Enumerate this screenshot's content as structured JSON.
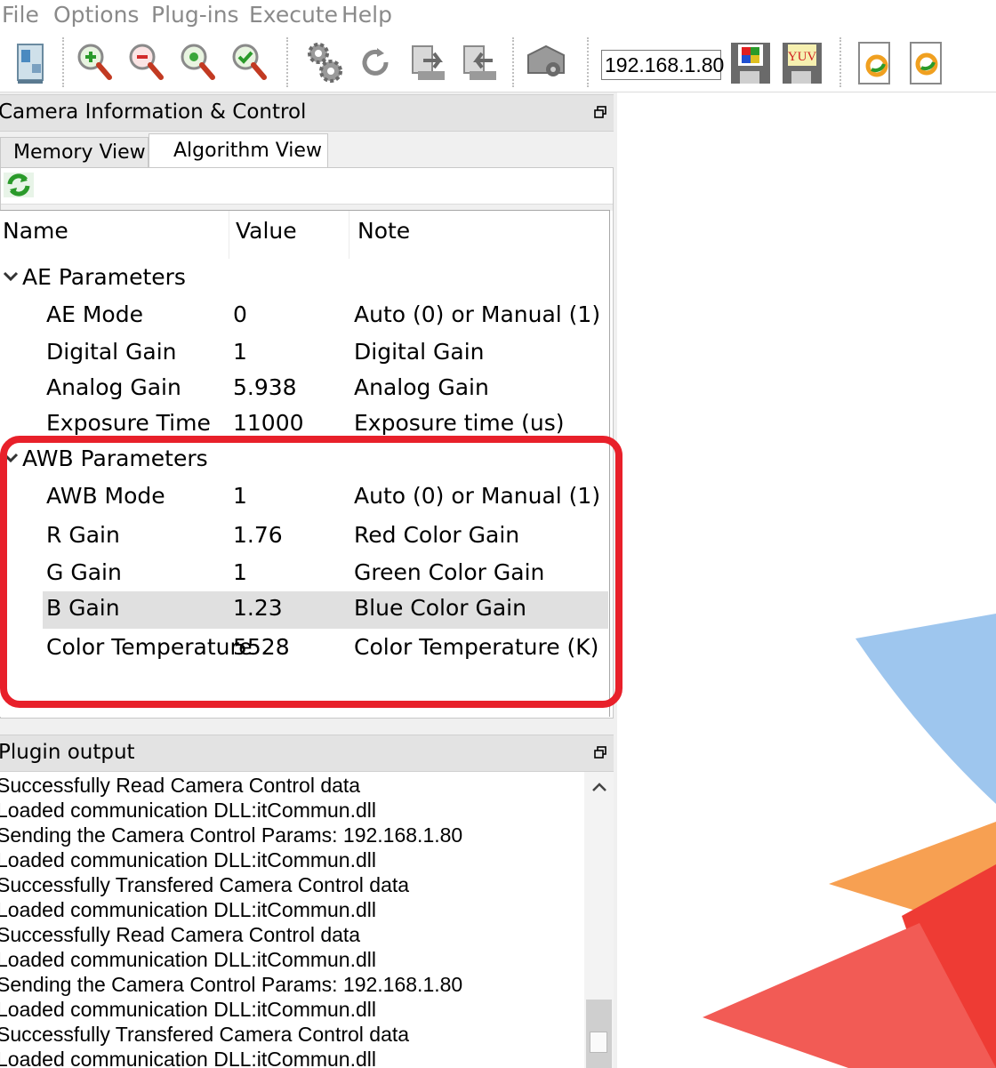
{
  "menu": {
    "items": [
      "File",
      "Options",
      "Plug-ins",
      "Execute",
      "Help"
    ]
  },
  "toolbar": {
    "ip_address": "192.168.1.80",
    "yuv_label": "YUV",
    "icons": [
      "device-info-icon",
      "zoom-in-icon",
      "zoom-out-icon",
      "zoom-fit-icon",
      "zoom-check-icon",
      "settings-gears-icon",
      "refresh-icon",
      "send-icon",
      "receive-icon",
      "camera-icon",
      "save-rgb-icon",
      "save-yuv-icon",
      "plugin-doc-icon",
      "plugin-doc-2-icon"
    ]
  },
  "camera_panel": {
    "title": "Camera Information & Control",
    "tabs": [
      "Memory View",
      "Algorithm View"
    ],
    "active_tab": "Algorithm View",
    "columns": [
      "Name",
      "Value",
      "Note"
    ],
    "groups": [
      {
        "name": "AE Parameters",
        "rows": [
          {
            "name": "AE Mode",
            "value": "0",
            "note": "Auto (0) or Manual (1)"
          },
          {
            "name": "Digital Gain",
            "value": "1",
            "note": "Digital Gain"
          },
          {
            "name": "Analog Gain",
            "value": "5.938",
            "note": "Analog Gain"
          },
          {
            "name": "Exposure Time",
            "value": "11000",
            "note": "Exposure time (us)"
          }
        ]
      },
      {
        "name": "AWB Parameters",
        "rows": [
          {
            "name": "AWB Mode",
            "value": "1",
            "note": "Auto (0) or Manual (1)"
          },
          {
            "name": "R Gain",
            "value": "1.76",
            "note": "Red Color Gain"
          },
          {
            "name": "G Gain",
            "value": "1",
            "note": "Green Color Gain"
          },
          {
            "name": "B Gain",
            "value": "1.23",
            "note": "Blue Color Gain"
          },
          {
            "name": "Color Temperature",
            "value": "5528",
            "note": "Color Temperature (K)"
          }
        ]
      }
    ],
    "selected_row": "B Gain",
    "highlight_color": "#e8202a"
  },
  "plugin_output": {
    "title": "Plugin output",
    "lines": [
      "Successfully Read Camera Control data",
      "Loaded communication DLL:itCommun.dll",
      "Sending the Camera Control Params: 192.168.1.80",
      "Loaded communication DLL:itCommun.dll",
      "Successfully Transfered Camera Control data",
      "Loaded communication DLL:itCommun.dll",
      "Successfully Read Camera Control data",
      "Loaded communication DLL:itCommun.dll",
      "Sending the Camera Control Params: 192.168.1.80",
      "Loaded communication DLL:itCommun.dll",
      "Successfully Transfered Camera Control data",
      "Loaded communication DLL:itCommun.dll"
    ]
  },
  "colors": {
    "blue_shape": "#9ec6ee",
    "orange_shape": "#f7a052",
    "red_shape": "#ee3b34"
  }
}
